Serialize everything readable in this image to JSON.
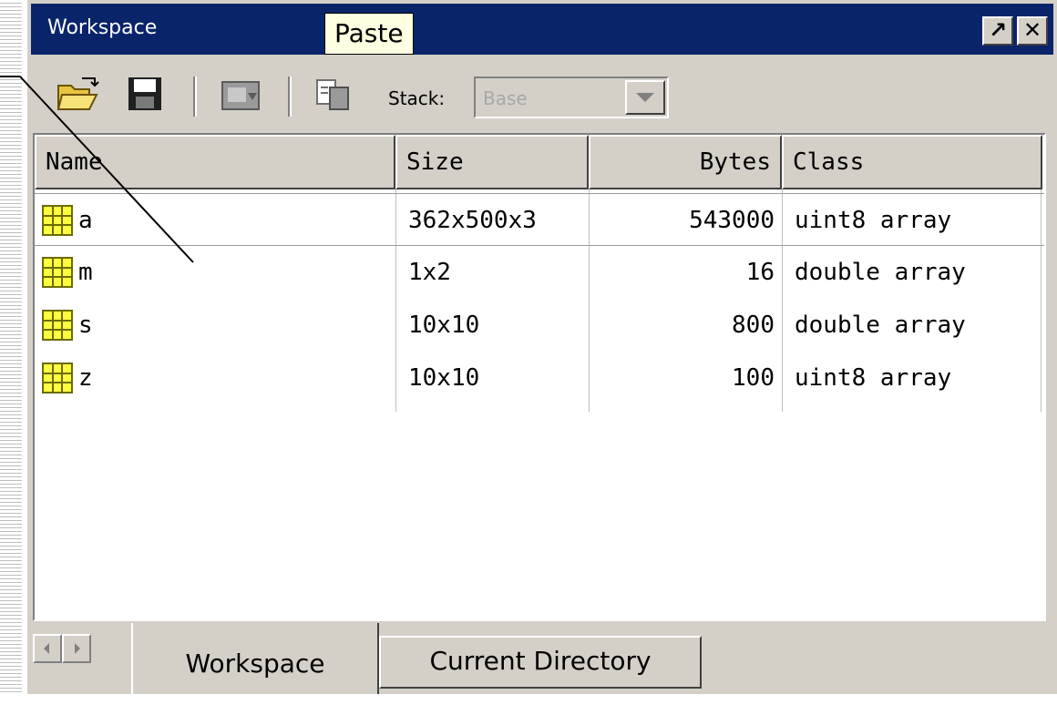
{
  "window": {
    "title": "Workspace"
  },
  "titlebar": {
    "undock_label": "↗",
    "close_label": "✕"
  },
  "tooltip": {
    "text": "Paste"
  },
  "toolbar": {
    "icons": [
      "open-folder-icon",
      "save-disk-icon",
      "import-data-icon",
      "paste-icon"
    ],
    "stack_label": "Stack:",
    "stack_value": "Base"
  },
  "table": {
    "columns": [
      "Name",
      "Size",
      "Bytes",
      "Class"
    ],
    "rows": [
      {
        "name": "a",
        "size": "362x500x3",
        "bytes": "543000",
        "class": "uint8 array"
      },
      {
        "name": "m",
        "size": "1x2",
        "bytes": "16",
        "class": "double array"
      },
      {
        "name": "s",
        "size": "10x10",
        "bytes": "800",
        "class": "double array"
      },
      {
        "name": "z",
        "size": "10x10",
        "bytes": "100",
        "class": "uint8 array"
      }
    ]
  },
  "tabs": {
    "workspace": "Workspace",
    "current_directory": "Current Directory"
  },
  "colors": {
    "title_bar": "#0a246a",
    "window_bg": "#d4d0c8",
    "tooltip_bg": "#ffffe1",
    "variable_icon": "#ffff40"
  }
}
